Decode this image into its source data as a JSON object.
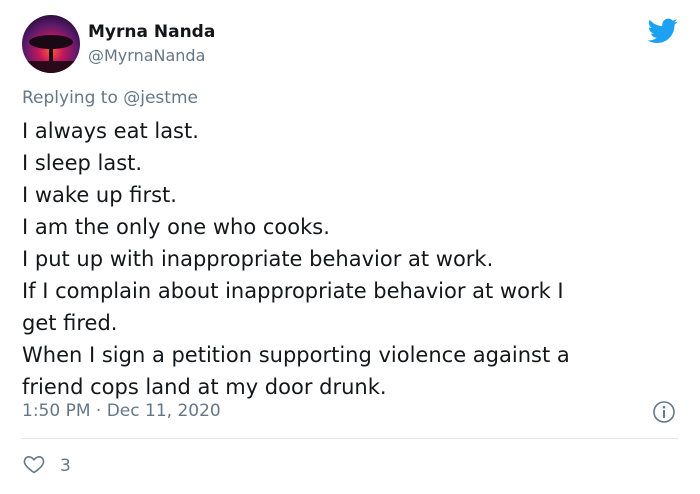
{
  "user": {
    "name": "Myrna Nanda",
    "handle": "@MyrnaNanda"
  },
  "reply": {
    "prefix": "Replying to",
    "mention": "@jestme"
  },
  "body": {
    "lines": [
      "I always eat last.",
      "I sleep last.",
      "I wake up first.",
      "I am the only one who cooks.",
      "I put up with inappropriate behavior at work.",
      "If I complain about inappropriate behavior at work I",
      "get fired.",
      "When I sign a petition supporting violence against a",
      "friend cops land at my door drunk."
    ]
  },
  "meta": {
    "timestamp": "1:50 PM · Dec 11, 2020"
  },
  "engagement": {
    "likes": "3"
  },
  "icons": {
    "brand": "twitter-bird-icon",
    "info": "info-icon",
    "like": "heart-icon"
  },
  "colors": {
    "twitter_blue": "#1DA1F2",
    "secondary_text": "#657786",
    "primary_text": "#14171A",
    "divider": "#E1E8ED"
  }
}
